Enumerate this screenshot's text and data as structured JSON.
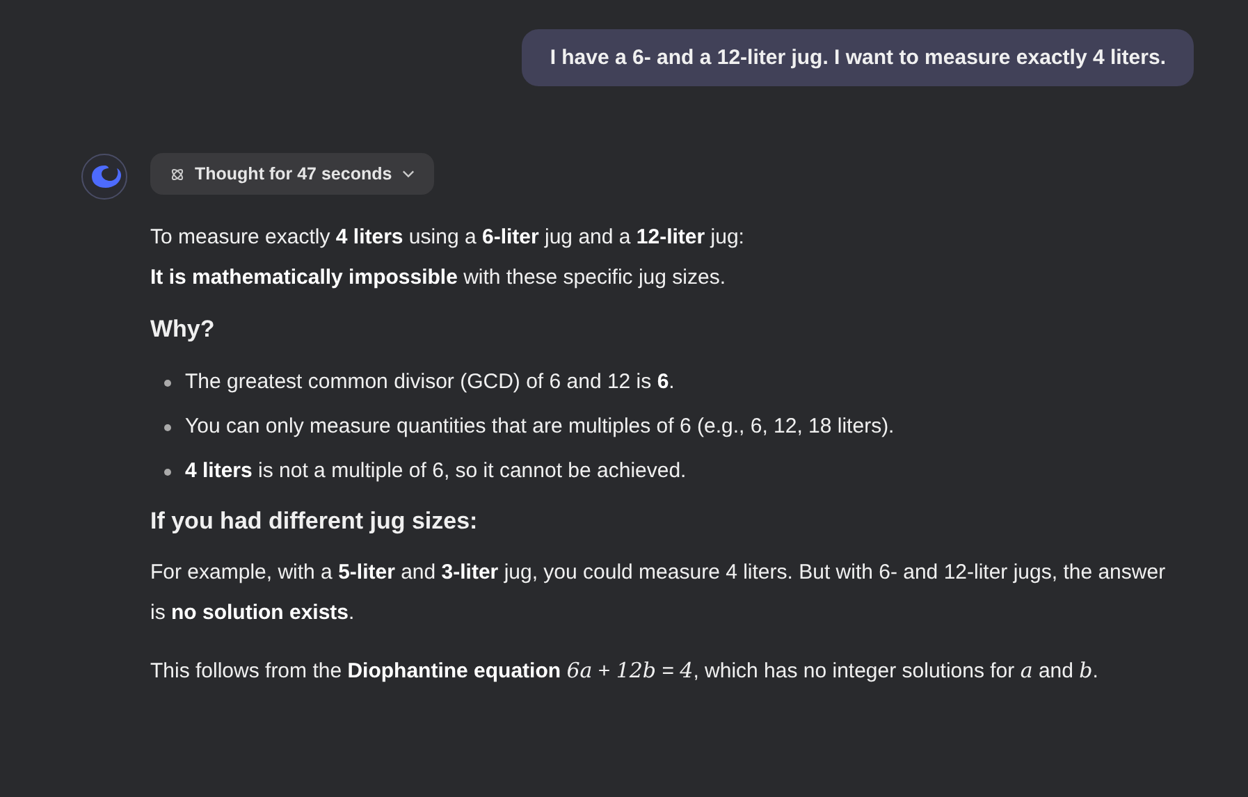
{
  "user_message": "I have a 6- and a 12-liter jug. I want to measure exactly 4 liters.",
  "thought_button": {
    "label": "Thought for 47 seconds",
    "expanded": false
  },
  "blocks": [
    {
      "kind": "paragraph",
      "lines": [
        "To measure exactly **4 liters** using a **6-liter** jug and a **12-liter** jug:",
        "**It is mathematically impossible** with these specific jug sizes."
      ]
    },
    {
      "kind": "heading",
      "text": "Why?"
    },
    {
      "kind": "list",
      "items": [
        "The greatest common divisor (GCD) of 6 and 12 is **6**.",
        "You can only measure quantities that are multiples of 6 (e.g., 6, 12, 18 liters).",
        "**4 liters** is not a multiple of 6, so it cannot be achieved."
      ]
    },
    {
      "kind": "heading",
      "text": "If you had different jug sizes:"
    },
    {
      "kind": "paragraph",
      "lines": [
        "For example, with a **5-liter** and **3-liter** jug, you could measure 4 liters. But with 6- and 12-liter jugs, the answer is **no solution exists**."
      ]
    },
    {
      "kind": "paragraph",
      "lines": [
        "This follows from the **Diophantine equation** *6a* + *12b* = *4*, which has no integer solutions for *a* and *b*."
      ]
    }
  ]
}
